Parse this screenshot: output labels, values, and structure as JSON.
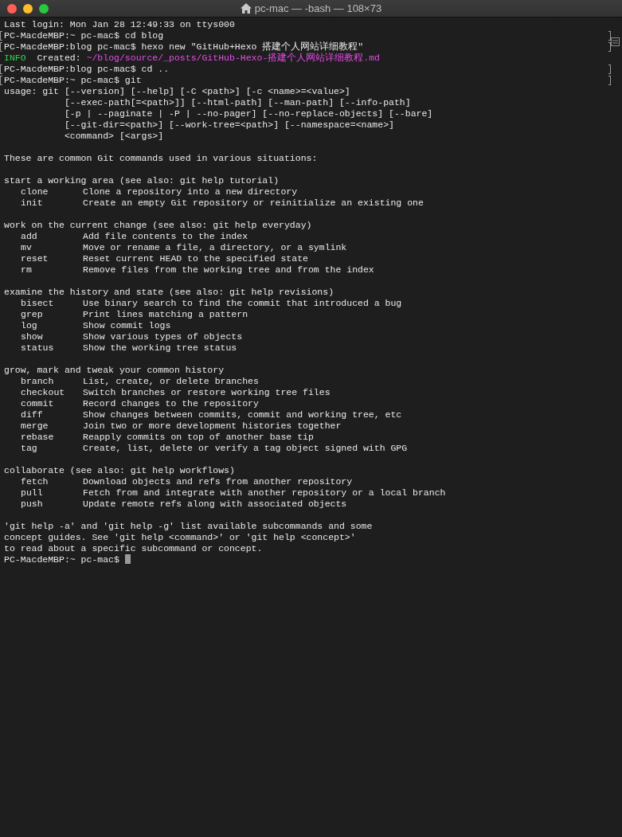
{
  "window": {
    "title": "pc-mac — -bash — 108×73"
  },
  "lines": [
    {
      "kind": "text",
      "marked": false,
      "text": "Last login: Mon Jan 28 12:49:33 on ttys000"
    },
    {
      "kind": "prompt",
      "marked": true,
      "prompt": "PC-MacdeMBP:~ pc-mac$",
      "command": "cd blog"
    },
    {
      "kind": "prompt",
      "marked": true,
      "prompt": "PC-MacdeMBP:blog pc-mac$",
      "command": "hexo new \"GitHub+Hexo 搭建个人网站详细教程\""
    },
    {
      "kind": "info",
      "marked": false,
      "tag": "INFO",
      "text": "Created:",
      "path": "~/blog/source/_posts/GitHub-Hexo-搭建个人网站详细教程.md"
    },
    {
      "kind": "prompt",
      "marked": true,
      "prompt": "PC-MacdeMBP:blog pc-mac$",
      "command": "cd .."
    },
    {
      "kind": "prompt",
      "marked": true,
      "prompt": "PC-MacdeMBP:~ pc-mac$",
      "command": "git"
    },
    {
      "kind": "text",
      "marked": false,
      "text": "usage: git [--version] [--help] [-C <path>] [-c <name>=<value>]"
    },
    {
      "kind": "continuation",
      "marked": false,
      "text": "[--exec-path[=<path>]] [--html-path] [--man-path] [--info-path]"
    },
    {
      "kind": "continuation",
      "marked": false,
      "text": "[-p | --paginate | -P | --no-pager] [--no-replace-objects] [--bare]"
    },
    {
      "kind": "continuation",
      "marked": false,
      "text": "[--git-dir=<path>] [--work-tree=<path>] [--namespace=<name>]"
    },
    {
      "kind": "continuation",
      "marked": false,
      "text": "<command> [<args>]"
    },
    {
      "kind": "blank",
      "marked": false
    },
    {
      "kind": "text",
      "marked": false,
      "text": "These are common Git commands used in various situations:"
    },
    {
      "kind": "blank",
      "marked": false
    },
    {
      "kind": "text",
      "marked": false,
      "text": "start a working area (see also: git help tutorial)"
    },
    {
      "kind": "command",
      "marked": false,
      "name": "clone",
      "description": "Clone a repository into a new directory"
    },
    {
      "kind": "command",
      "marked": false,
      "name": "init",
      "description": "Create an empty Git repository or reinitialize an existing one"
    },
    {
      "kind": "blank",
      "marked": false
    },
    {
      "kind": "text",
      "marked": false,
      "text": "work on the current change (see also: git help everyday)"
    },
    {
      "kind": "command",
      "marked": false,
      "name": "add",
      "description": "Add file contents to the index"
    },
    {
      "kind": "command",
      "marked": false,
      "name": "mv",
      "description": "Move or rename a file, a directory, or a symlink"
    },
    {
      "kind": "command",
      "marked": false,
      "name": "reset",
      "description": "Reset current HEAD to the specified state"
    },
    {
      "kind": "command",
      "marked": false,
      "name": "rm",
      "description": "Remove files from the working tree and from the index"
    },
    {
      "kind": "blank",
      "marked": false
    },
    {
      "kind": "text",
      "marked": false,
      "text": "examine the history and state (see also: git help revisions)"
    },
    {
      "kind": "command",
      "marked": false,
      "name": "bisect",
      "description": "Use binary search to find the commit that introduced a bug"
    },
    {
      "kind": "command",
      "marked": false,
      "name": "grep",
      "description": "Print lines matching a pattern"
    },
    {
      "kind": "command",
      "marked": false,
      "name": "log",
      "description": "Show commit logs"
    },
    {
      "kind": "command",
      "marked": false,
      "name": "show",
      "description": "Show various types of objects"
    },
    {
      "kind": "command",
      "marked": false,
      "name": "status",
      "description": "Show the working tree status"
    },
    {
      "kind": "blank",
      "marked": false
    },
    {
      "kind": "text",
      "marked": false,
      "text": "grow, mark and tweak your common history"
    },
    {
      "kind": "command",
      "marked": false,
      "name": "branch",
      "description": "List, create, or delete branches"
    },
    {
      "kind": "command",
      "marked": false,
      "name": "checkout",
      "description": "Switch branches or restore working tree files"
    },
    {
      "kind": "command",
      "marked": false,
      "name": "commit",
      "description": "Record changes to the repository"
    },
    {
      "kind": "command",
      "marked": false,
      "name": "diff",
      "description": "Show changes between commits, commit and working tree, etc"
    },
    {
      "kind": "command",
      "marked": false,
      "name": "merge",
      "description": "Join two or more development histories together"
    },
    {
      "kind": "command",
      "marked": false,
      "name": "rebase",
      "description": "Reapply commits on top of another base tip"
    },
    {
      "kind": "command",
      "marked": false,
      "name": "tag",
      "description": "Create, list, delete or verify a tag object signed with GPG"
    },
    {
      "kind": "blank",
      "marked": false
    },
    {
      "kind": "text",
      "marked": false,
      "text": "collaborate (see also: git help workflows)"
    },
    {
      "kind": "command",
      "marked": false,
      "name": "fetch",
      "description": "Download objects and refs from another repository"
    },
    {
      "kind": "command",
      "marked": false,
      "name": "pull",
      "description": "Fetch from and integrate with another repository or a local branch"
    },
    {
      "kind": "command",
      "marked": false,
      "name": "push",
      "description": "Update remote refs along with associated objects"
    },
    {
      "kind": "blank",
      "marked": false
    },
    {
      "kind": "text",
      "marked": false,
      "text": "'git help -a' and 'git help -g' list available subcommands and some"
    },
    {
      "kind": "text",
      "marked": false,
      "text": "concept guides. See 'git help <command>' or 'git help <concept>'"
    },
    {
      "kind": "text",
      "marked": false,
      "text": "to read about a specific subcommand or concept."
    },
    {
      "kind": "prompt",
      "marked": false,
      "prompt": "PC-MacdeMBP:~ pc-mac$",
      "cursor": true
    }
  ]
}
